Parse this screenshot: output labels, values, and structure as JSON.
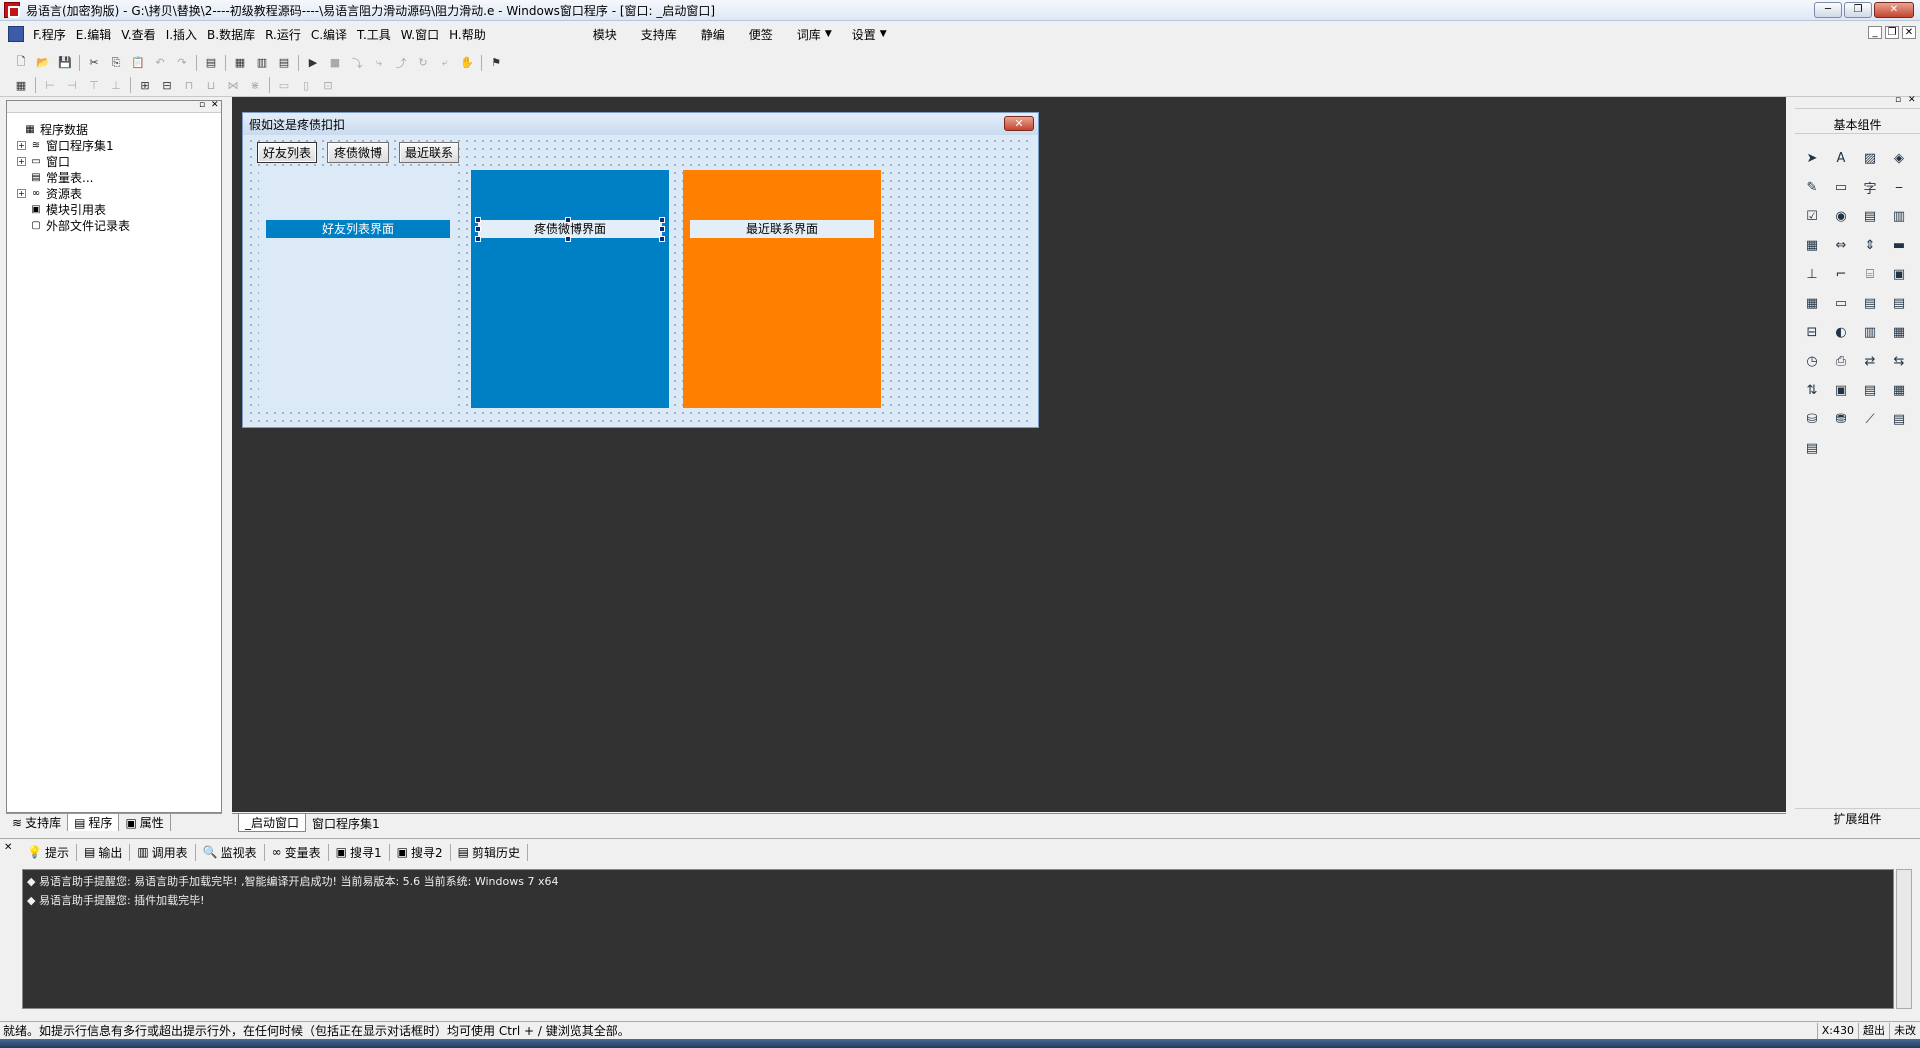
{
  "window": {
    "title": "易语言(加密狗版) - G:\\拷贝\\替换\\2----初级教程源码----\\易语言阻力滑动源码\\阻力滑动.e - Windows窗口程序 - [窗口: _启动窗口]",
    "minimize": "─",
    "restore": "❐",
    "close": "✕"
  },
  "menu": {
    "items": [
      "F.程序",
      "E.编辑",
      "V.查看",
      "I.插入",
      "B.数据库",
      "R.运行",
      "C.编译",
      "T.工具",
      "W.窗口",
      "H.帮助"
    ],
    "extra": [
      "模块",
      "支持库",
      "静编",
      "便签",
      "词库",
      "设置"
    ]
  },
  "left_panel": {
    "tree": [
      {
        "label": "程序数据",
        "icon": "program-data-icon",
        "glyph": "▦",
        "level": 0,
        "expander": ""
      },
      {
        "label": "窗口程序集1",
        "icon": "assembly-icon",
        "glyph": "≋",
        "level": 1,
        "expander": "+"
      },
      {
        "label": "窗口",
        "icon": "window-icon",
        "glyph": "▭",
        "level": 1,
        "expander": "+"
      },
      {
        "label": "常量表...",
        "icon": "constant-icon",
        "glyph": "▤",
        "level": 1,
        "expander": ""
      },
      {
        "label": "资源表",
        "icon": "resource-icon",
        "glyph": "∞",
        "level": 1,
        "expander": "+"
      },
      {
        "label": "模块引用表",
        "icon": "module-icon",
        "glyph": "▣",
        "level": 1,
        "expander": ""
      },
      {
        "label": "外部文件记录表",
        "icon": "external-file-icon",
        "glyph": "▢",
        "level": 1,
        "expander": ""
      }
    ],
    "tabs": [
      "支持库",
      "程序",
      "属性"
    ]
  },
  "form": {
    "title": "假如这是疼债扣扣",
    "close_glyph": "✕",
    "buttons": [
      "好友列表",
      "疼债微博",
      "最近联系"
    ],
    "panels": [
      {
        "label": "好友列表界面",
        "bg": "#dceaf8",
        "label_bg": "#0080c4",
        "label_color": "#ffffff"
      },
      {
        "label": "疼债微博界面",
        "bg": "#0080c4",
        "label_bg": "#e4eef8",
        "label_color": "#000000"
      },
      {
        "label": "最近联系界面",
        "bg": "#ff8000",
        "label_bg": "#e4eef8",
        "label_color": "#000000"
      }
    ]
  },
  "doc_tabs": [
    "_启动窗口",
    "窗口程序集1"
  ],
  "right_panel": {
    "title": "基本组件",
    "footer": "扩展组件",
    "icons": [
      "pointer-icon",
      "label-icon",
      "picture-icon",
      "shape-icon",
      "edit-icon",
      "frame-icon",
      "char-icon",
      "line-icon",
      "checkbox-icon",
      "radio-icon",
      "combobox-icon",
      "listbox-icon",
      "table-icon",
      "scroll-icon",
      "vscroll-icon",
      "progress-icon",
      "ruler-icon",
      "corner-icon",
      "tool-icon",
      "image-box-icon",
      "grid-icon",
      "textbox-icon",
      "folder-icon",
      "doc-icon",
      "tabs-icon",
      "paint-icon",
      "splitter-icon",
      "calendar-icon",
      "timer-icon",
      "printer-icon",
      "net-icon",
      "client-icon",
      "server-icon",
      "tray-icon",
      "list-icon",
      "datagrid-icon",
      "db-icon",
      "db2-icon",
      "chart-icon",
      "odbc-icon",
      "odbc2-icon"
    ]
  },
  "bottom_panel": {
    "tabs": [
      "提示",
      "输出",
      "调用表",
      "监视表",
      "变量表",
      "搜寻1",
      "搜寻2",
      "剪辑历史"
    ],
    "tab_icons": [
      "hint-icon",
      "output-icon",
      "callstack-icon",
      "watch-icon",
      "variable-icon",
      "search1-icon",
      "search2-icon",
      "clipboard-icon"
    ],
    "tab_glyphs": [
      "💡",
      "▤",
      "▥",
      "🔍",
      "∞",
      "▣",
      "▣",
      "▤"
    ],
    "lines": [
      "◆ 易语言助手提醒您: 易语言助手加载完毕! ,智能编译开启成功! 当前易版本: 5.6 当前系统: Windows 7 x64",
      "◆ 易语言助手提醒您: 插件加载完毕!"
    ]
  },
  "status": {
    "text": "就绪。如提示行信息有多行或超出提示行外，在任何时候（包括正在显示对话框时）均可使用 Ctrl + / 键浏览其全部。",
    "coord": "X:430",
    "mode": "超出",
    "modified": "未改"
  }
}
